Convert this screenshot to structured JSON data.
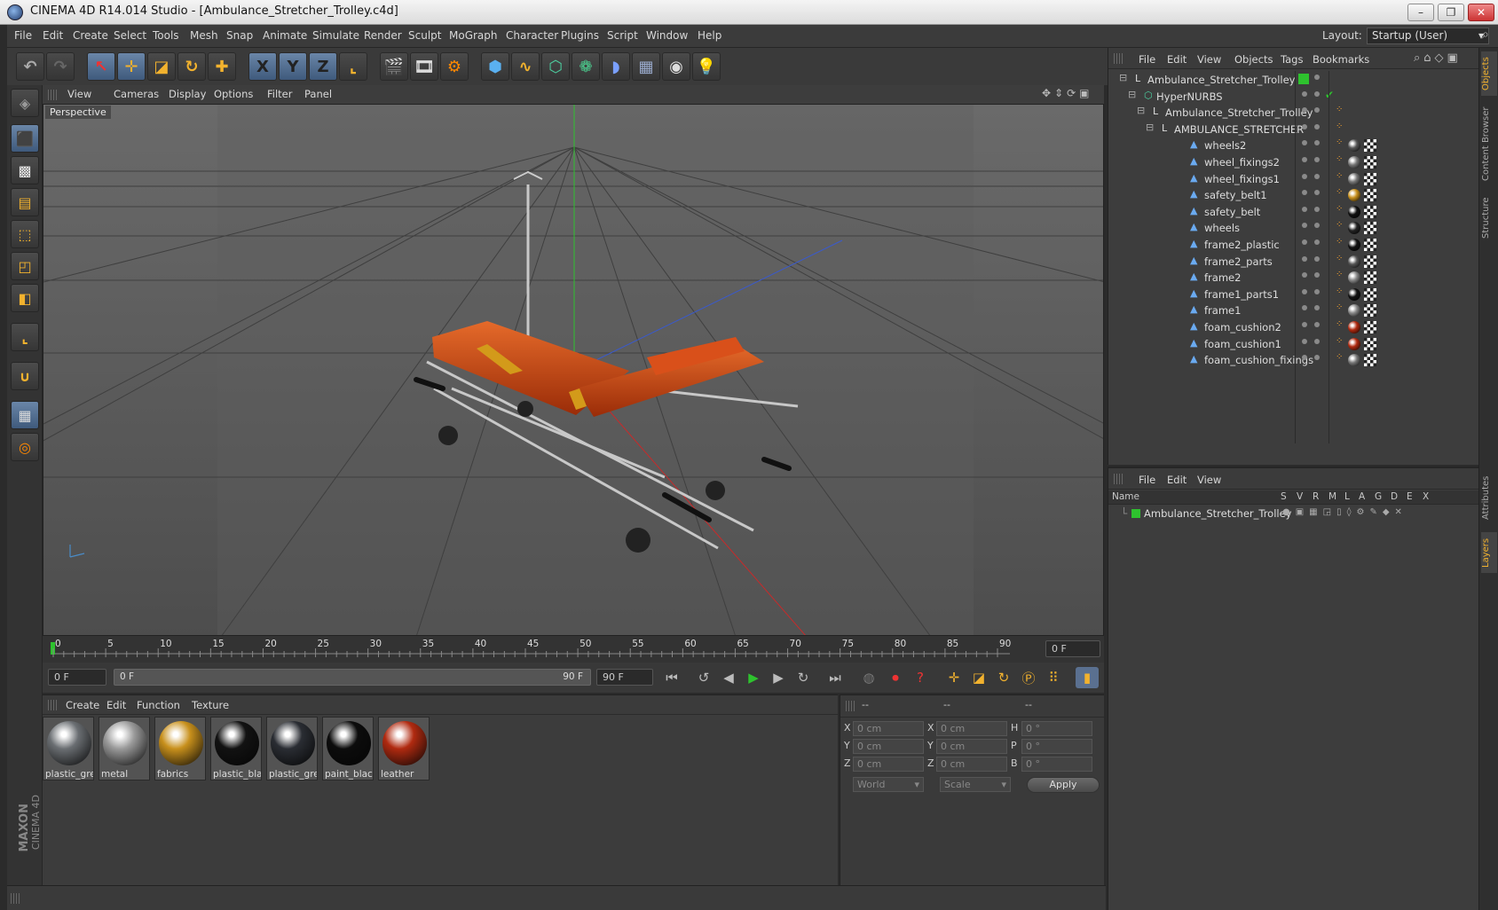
{
  "window": {
    "title": "CINEMA 4D R14.014 Studio - [Ambulance_Stretcher_Trolley.c4d]",
    "controls": [
      "–",
      "❐",
      "✕"
    ]
  },
  "menubar": {
    "items": [
      "File",
      "Edit",
      "Create",
      "Select",
      "Tools",
      "Mesh",
      "Snap",
      "Animate",
      "Simulate",
      "Render",
      "Sculpt",
      "MoGraph",
      "Character",
      "Plugins",
      "Script",
      "Window",
      "Help"
    ],
    "layout_label": "Layout:",
    "layout_value": "Startup (User)"
  },
  "toolbar": {
    "icons": [
      "undo-icon",
      "redo-icon",
      "live-selection-icon",
      "move-icon",
      "scale-icon",
      "rotate-icon",
      "recent-tool-icon",
      "x-axis-icon",
      "y-axis-icon",
      "z-axis-icon",
      "world-coord-icon",
      "render-view-icon",
      "render-picture-viewer-icon",
      "render-settings-icon",
      "cube-primitive-icon",
      "spline-icon",
      "nurbs-icon",
      "array-icon",
      "deformer-icon",
      "floor-icon",
      "camera-icon",
      "light-icon"
    ],
    "axis_labels": [
      "X",
      "Y",
      "Z"
    ]
  },
  "lefttools": {
    "icons": [
      "make-editable-icon",
      "model-mode-icon",
      "texture-mode-icon",
      "workplane-icon",
      "points-mode-icon",
      "edges-mode-icon",
      "polygons-mode-icon",
      "axis-mode-icon",
      "magnet-icon",
      "snap-grid-icon",
      "snap-settings-icon"
    ]
  },
  "brand": {
    "company": "MAXON",
    "product": "CINEMA 4D"
  },
  "viewport": {
    "menu": [
      "View",
      "Cameras",
      "Display",
      "Options",
      "Filter",
      "Panel"
    ],
    "label": "Perspective"
  },
  "timeline": {
    "ticks": [
      "0",
      "5",
      "10",
      "15",
      "20",
      "25",
      "30",
      "35",
      "40",
      "45",
      "50",
      "55",
      "60",
      "65",
      "70",
      "75",
      "80",
      "85",
      "90"
    ],
    "current_frame": "0 F"
  },
  "transport": {
    "start": "0 F",
    "range_start": "0 F",
    "range_end": "90 F",
    "end": "90 F"
  },
  "materials": {
    "menu": [
      "Create",
      "Edit",
      "Function",
      "Texture"
    ],
    "items": [
      {
        "name": "plastic_gre",
        "color": "#6a6e72"
      },
      {
        "name": "metal",
        "color": "#9a9a9a"
      },
      {
        "name": "fabrics",
        "color": "#c8901c"
      },
      {
        "name": "plastic_bla",
        "color": "#121212"
      },
      {
        "name": "plastic_gre",
        "color": "#2a2d33"
      },
      {
        "name": "paint_black",
        "color": "#0c0c0c"
      },
      {
        "name": "leather",
        "color": "#b02a10"
      }
    ]
  },
  "coords": {
    "headers": [
      "--",
      "--",
      "--"
    ],
    "rows": [
      {
        "a": "X",
        "av": "0 cm",
        "b": "X",
        "bv": "0 cm",
        "c": "H",
        "cv": "0 °"
      },
      {
        "a": "Y",
        "av": "0 cm",
        "b": "Y",
        "bv": "0 cm",
        "c": "P",
        "cv": "0 °"
      },
      {
        "a": "Z",
        "av": "0 cm",
        "b": "Z",
        "bv": "0 cm",
        "c": "B",
        "cv": "0 °"
      }
    ],
    "world": "World",
    "scale": "Scale",
    "apply": "Apply"
  },
  "objects": {
    "menu": [
      "File",
      "Edit",
      "View",
      "Objects",
      "Tags",
      "Bookmarks"
    ],
    "items": [
      {
        "name": "Ambulance_Stretcher_Trolley",
        "depth": 0,
        "tag": ""
      },
      {
        "name": "HyperNURBS",
        "depth": 1,
        "tag": ""
      },
      {
        "name": "Ambulance_Stretcher_Trolley",
        "depth": 2,
        "tag": ""
      },
      {
        "name": "AMBULANCE_STRETCHER",
        "depth": 3,
        "tag": ""
      },
      {
        "name": "wheels2",
        "depth": 4,
        "tag": "#555"
      },
      {
        "name": "wheel_fixings2",
        "depth": 4,
        "tag": "#777"
      },
      {
        "name": "wheel_fixings1",
        "depth": 4,
        "tag": "#777"
      },
      {
        "name": "safety_belt1",
        "depth": 4,
        "tag": "#c8901c"
      },
      {
        "name": "safety_belt",
        "depth": 4,
        "tag": "#111"
      },
      {
        "name": "wheels",
        "depth": 4,
        "tag": "#222"
      },
      {
        "name": "frame2_plastic",
        "depth": 4,
        "tag": "#111"
      },
      {
        "name": "frame2_parts",
        "depth": 4,
        "tag": "#555"
      },
      {
        "name": "frame2",
        "depth": 4,
        "tag": "#888"
      },
      {
        "name": "frame1_parts1",
        "depth": 4,
        "tag": "#111"
      },
      {
        "name": "frame1",
        "depth": 4,
        "tag": "#888"
      },
      {
        "name": "foam_cushion2",
        "depth": 4,
        "tag": "#b02a10"
      },
      {
        "name": "foam_cushion1",
        "depth": 4,
        "tag": "#b02a10"
      },
      {
        "name": "foam_cushion_fixings",
        "depth": 4,
        "tag": "#777"
      }
    ]
  },
  "layers": {
    "menu": [
      "File",
      "Edit",
      "View"
    ],
    "columns": [
      "Name",
      "S",
      "V",
      "R",
      "M",
      "L",
      "A",
      "G",
      "D",
      "E",
      "X"
    ],
    "rows": [
      {
        "name": "Ambulance_Stretcher_Trolley",
        "color": "#2ec22e"
      }
    ]
  },
  "rightstrip": {
    "top_tabs": [
      "Objects",
      "Content Browser",
      "Structure"
    ],
    "bottom_tabs": [
      "Attributes",
      "Layers"
    ]
  }
}
